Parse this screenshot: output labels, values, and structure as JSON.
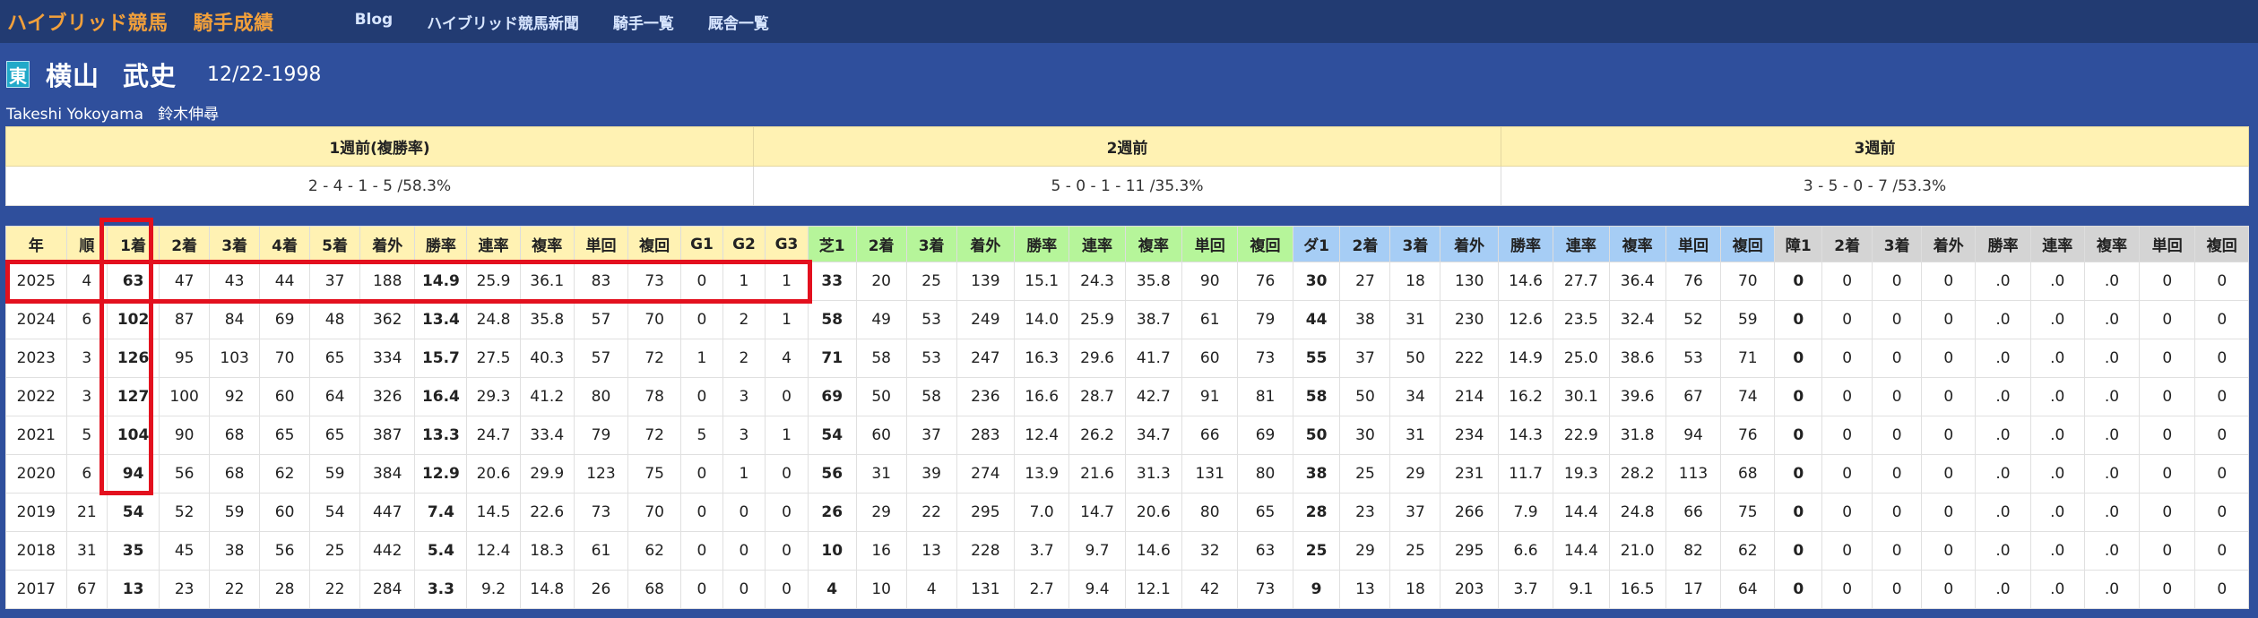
{
  "nav": {
    "brand_main": "ハイブリッド競馬",
    "brand_sub": "騎手成績",
    "links": [
      "Blog",
      "ハイブリッド競馬新聞",
      "騎手一覧",
      "厩舎一覧"
    ]
  },
  "jockey": {
    "affiliation_badge": "東",
    "surname": "横山",
    "given_name": "武史",
    "debut_date": "12/22-1998",
    "name_en": "Takeshi Yokoyama",
    "stable": "鈴木伸尋"
  },
  "weeks": {
    "headers": [
      "1週前(複勝率)",
      "2週前",
      "3週前"
    ],
    "values": [
      "2 - 4 - 1 - 5 /58.3%",
      "5 - 0 - 1 - 11 /35.3%",
      "3 - 5 - 0 - 7 /53.3%"
    ]
  },
  "stats": {
    "headers": [
      "年",
      "順",
      "1着",
      "2着",
      "3着",
      "4着",
      "5着",
      "着外",
      "勝率",
      "連率",
      "複率",
      "単回",
      "複回",
      "G1",
      "G2",
      "G3",
      "芝1",
      "2着",
      "3着",
      "着外",
      "勝率",
      "連率",
      "複率",
      "単回",
      "複回",
      "ダ1",
      "2着",
      "3着",
      "着外",
      "勝率",
      "連率",
      "複率",
      "単回",
      "複回",
      "障1",
      "2着",
      "3着",
      "着外",
      "勝率",
      "連率",
      "複率",
      "単回",
      "複回"
    ],
    "rows": [
      [
        "2025",
        "4",
        "63",
        "47",
        "43",
        "44",
        "37",
        "188",
        "14.9",
        "25.9",
        "36.1",
        "83",
        "73",
        "0",
        "1",
        "1",
        "33",
        "20",
        "25",
        "139",
        "15.1",
        "24.3",
        "35.8",
        "90",
        "76",
        "30",
        "27",
        "18",
        "130",
        "14.6",
        "27.7",
        "36.4",
        "76",
        "70",
        "0",
        "0",
        "0",
        "0",
        ".0",
        ".0",
        ".0",
        "0",
        "0"
      ],
      [
        "2024",
        "6",
        "102",
        "87",
        "84",
        "69",
        "48",
        "362",
        "13.4",
        "24.8",
        "35.8",
        "57",
        "70",
        "0",
        "2",
        "1",
        "58",
        "49",
        "53",
        "249",
        "14.0",
        "25.9",
        "38.7",
        "61",
        "79",
        "44",
        "38",
        "31",
        "230",
        "12.6",
        "23.5",
        "32.4",
        "52",
        "59",
        "0",
        "0",
        "0",
        "0",
        ".0",
        ".0",
        ".0",
        "0",
        "0"
      ],
      [
        "2023",
        "3",
        "126",
        "95",
        "103",
        "70",
        "65",
        "334",
        "15.7",
        "27.5",
        "40.3",
        "57",
        "72",
        "1",
        "2",
        "4",
        "71",
        "58",
        "53",
        "247",
        "16.3",
        "29.6",
        "41.7",
        "60",
        "73",
        "55",
        "37",
        "50",
        "222",
        "14.9",
        "25.0",
        "38.6",
        "53",
        "71",
        "0",
        "0",
        "0",
        "0",
        ".0",
        ".0",
        ".0",
        "0",
        "0"
      ],
      [
        "2022",
        "3",
        "127",
        "100",
        "92",
        "60",
        "64",
        "326",
        "16.4",
        "29.3",
        "41.2",
        "80",
        "78",
        "0",
        "3",
        "0",
        "69",
        "50",
        "58",
        "236",
        "16.6",
        "28.7",
        "42.7",
        "91",
        "81",
        "58",
        "50",
        "34",
        "214",
        "16.2",
        "30.1",
        "39.6",
        "67",
        "74",
        "0",
        "0",
        "0",
        "0",
        ".0",
        ".0",
        ".0",
        "0",
        "0"
      ],
      [
        "2021",
        "5",
        "104",
        "90",
        "68",
        "65",
        "65",
        "387",
        "13.3",
        "24.7",
        "33.4",
        "79",
        "72",
        "5",
        "3",
        "1",
        "54",
        "60",
        "37",
        "283",
        "12.4",
        "26.2",
        "34.7",
        "66",
        "69",
        "50",
        "30",
        "31",
        "234",
        "14.3",
        "22.9",
        "31.8",
        "94",
        "76",
        "0",
        "0",
        "0",
        "0",
        ".0",
        ".0",
        ".0",
        "0",
        "0"
      ],
      [
        "2020",
        "6",
        "94",
        "56",
        "68",
        "62",
        "59",
        "384",
        "12.9",
        "20.6",
        "29.9",
        "123",
        "75",
        "0",
        "1",
        "0",
        "56",
        "31",
        "39",
        "274",
        "13.9",
        "21.6",
        "31.3",
        "131",
        "80",
        "38",
        "25",
        "29",
        "231",
        "11.7",
        "19.3",
        "28.2",
        "113",
        "68",
        "0",
        "0",
        "0",
        "0",
        ".0",
        ".0",
        ".0",
        "0",
        "0"
      ],
      [
        "2019",
        "21",
        "54",
        "52",
        "59",
        "60",
        "54",
        "447",
        "7.4",
        "14.5",
        "22.6",
        "73",
        "70",
        "0",
        "0",
        "0",
        "26",
        "29",
        "22",
        "295",
        "7.0",
        "14.7",
        "20.6",
        "80",
        "65",
        "28",
        "23",
        "37",
        "266",
        "7.9",
        "14.4",
        "24.8",
        "66",
        "75",
        "0",
        "0",
        "0",
        "0",
        ".0",
        ".0",
        ".0",
        "0",
        "0"
      ],
      [
        "2018",
        "31",
        "35",
        "45",
        "38",
        "56",
        "25",
        "442",
        "5.4",
        "12.4",
        "18.3",
        "61",
        "62",
        "0",
        "0",
        "0",
        "10",
        "16",
        "13",
        "228",
        "3.7",
        "9.7",
        "14.6",
        "32",
        "63",
        "25",
        "29",
        "25",
        "295",
        "6.6",
        "14.4",
        "21.0",
        "82",
        "62",
        "0",
        "0",
        "0",
        "0",
        ".0",
        ".0",
        ".0",
        "0",
        "0"
      ],
      [
        "2017",
        "67",
        "13",
        "23",
        "22",
        "28",
        "22",
        "284",
        "3.3",
        "9.2",
        "14.8",
        "26",
        "68",
        "0",
        "0",
        "0",
        "4",
        "10",
        "4",
        "131",
        "2.7",
        "9.4",
        "12.1",
        "42",
        "73",
        "9",
        "13",
        "18",
        "203",
        "3.7",
        "9.1",
        "16.5",
        "17",
        "64",
        "0",
        "0",
        "0",
        "0",
        ".0",
        ".0",
        ".0",
        "0",
        "0"
      ]
    ]
  },
  "colors": {
    "overall": "#fff2b3",
    "turf": "#b6f59a",
    "dirt": "#a6cdf5",
    "jump": "#d4d4d4",
    "highlight": "#e3101e"
  }
}
